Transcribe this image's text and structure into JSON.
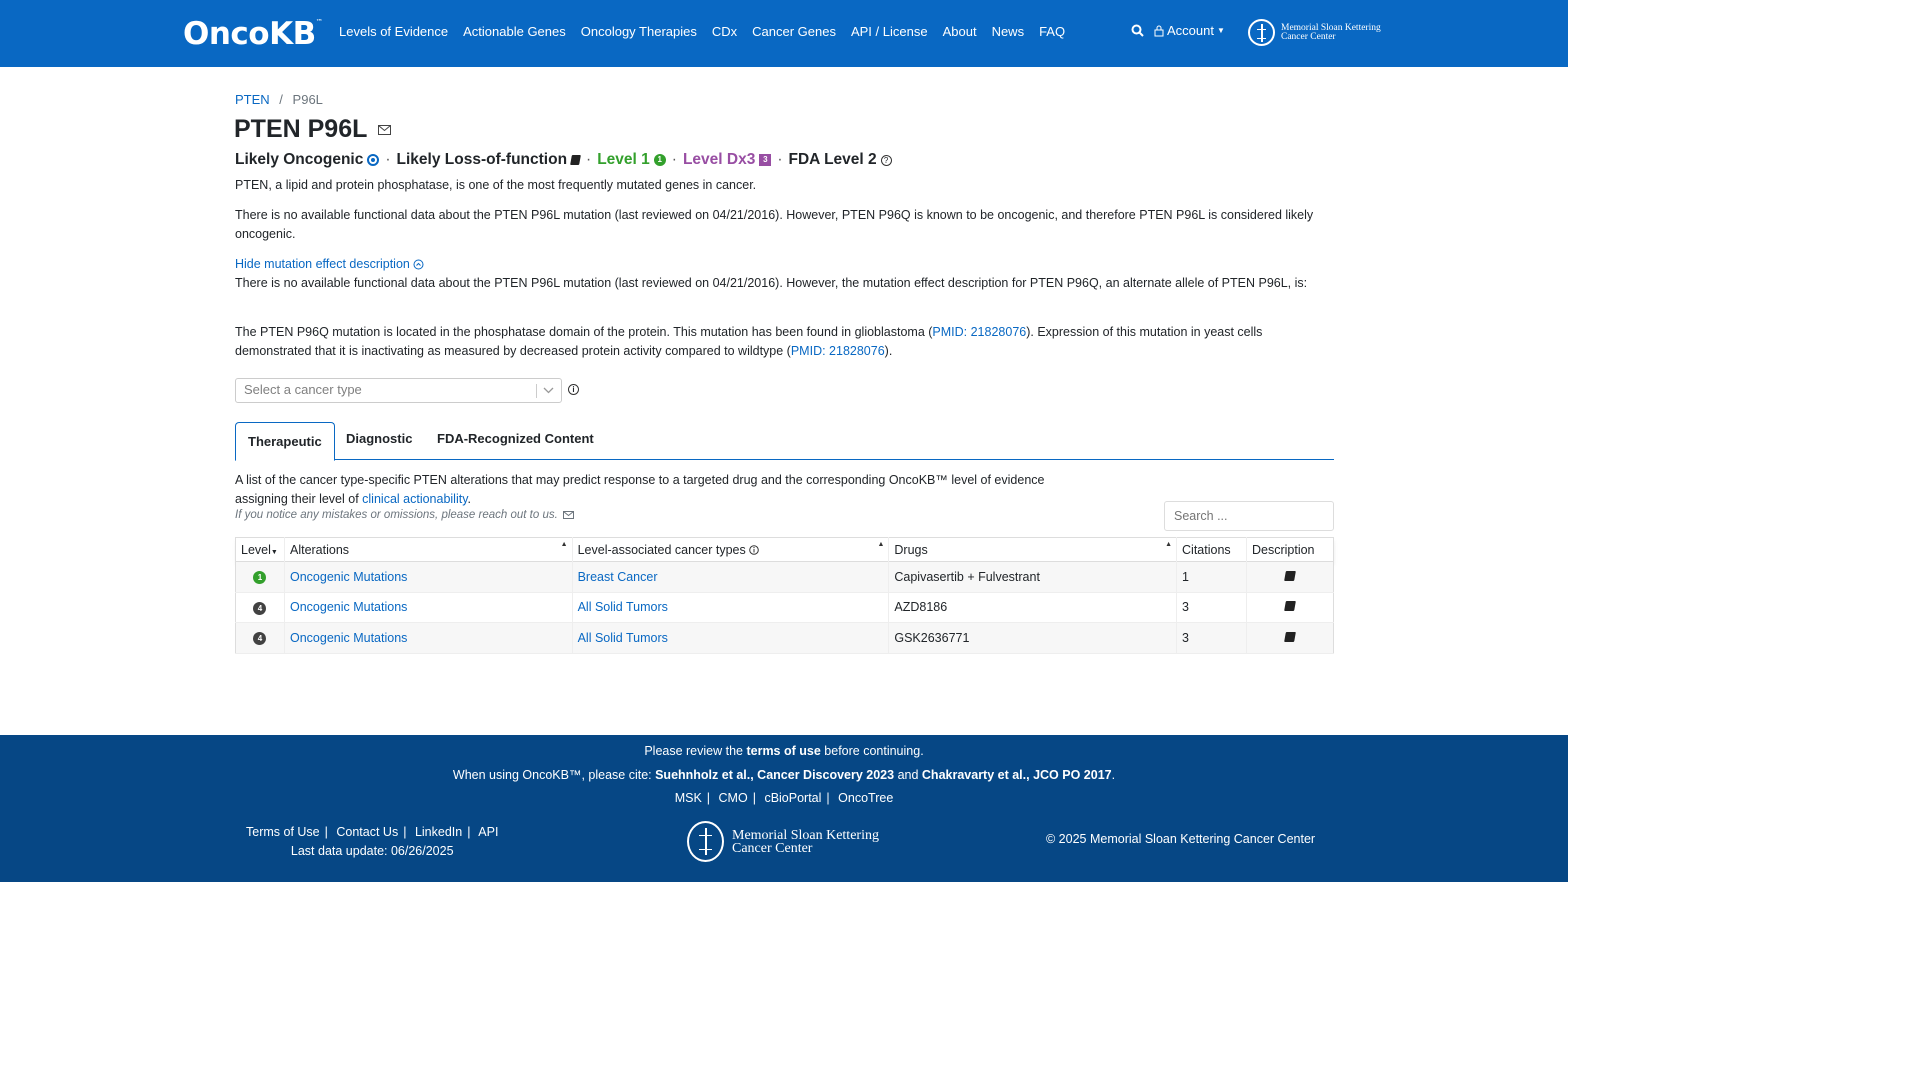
{
  "header": {
    "logo": "OncoKB",
    "logo_tm": "™",
    "nav": [
      "Levels of Evidence",
      "Actionable Genes",
      "Oncology Therapies",
      "CDx",
      "Cancer Genes",
      "API / License",
      "About",
      "News",
      "FAQ"
    ],
    "account": "Account",
    "msk_line1": "Memorial Sloan Kettering",
    "msk_line2": "Cancer Center"
  },
  "breadcrumb": {
    "gene": "PTEN",
    "sep": "/",
    "alteration": "P96L"
  },
  "title": "PTEN P96L",
  "status": {
    "oncogenic": "Likely Oncogenic",
    "effect": "Likely Loss-of-function",
    "level": "Level 1",
    "level_badge": "1",
    "dx": "Level Dx3",
    "dx_badge": "3",
    "fda": "FDA Level 2",
    "dot": "·"
  },
  "summary": {
    "gene_summary": "PTEN, a lipid and protein phosphatase, is one of the most frequently mutated genes in cancer.",
    "variant_summary": "There is no available functional data about the PTEN P96L mutation (last reviewed on 04/21/2016). However, PTEN P96Q is known to be oncogenic, and therefore PTEN P96L is considered likely oncogenic.",
    "toggle": "Hide mutation effect description",
    "effect_1": "There is no available functional data about the PTEN P96L mutation (last reviewed on 04/21/2016). However, the mutation effect description for PTEN P96Q, an alternate allele of PTEN P96L, is:",
    "effect_2_a": "The PTEN P96Q mutation is located in the phosphatase domain of the protein. This mutation has been found in glioblastoma (",
    "pmid_1": "PMID: 21828076",
    "effect_2_b": "). Expression of this mutation in yeast cells demonstrated that it is inactivating as measured by decreased protein activity compared to wildtype (",
    "pmid_2": "PMID: 21828076",
    "effect_2_c": ")."
  },
  "cancer_select": {
    "placeholder": "Select a cancer type"
  },
  "tabs": [
    "Therapeutic",
    "Diagnostic",
    "FDA-Recognized Content"
  ],
  "therapeutic": {
    "desc_a": "A list of the cancer type-specific PTEN alterations that may predict response to a targeted drug and the corresponding OncoKB™ level of evidence assigning their level of ",
    "desc_link": "clinical actionability",
    "desc_b": ".",
    "note": "If you notice any mistakes or omissions, please reach out to us.",
    "search_placeholder": "Search ...",
    "columns": [
      "Level",
      "Alterations",
      "Level-associated cancer types",
      "Drugs",
      "Citations",
      "Description"
    ],
    "rows": [
      {
        "level": "1",
        "level_color": "#33a02c",
        "alteration": "Oncogenic Mutations",
        "cancer": "Breast Cancer",
        "drugs": "Capivasertib + Fulvestrant",
        "citations": "1"
      },
      {
        "level": "4",
        "level_color": "#424242",
        "alteration": "Oncogenic Mutations",
        "cancer": "All Solid Tumors",
        "drugs": "AZD8186",
        "citations": "3"
      },
      {
        "level": "4",
        "level_color": "#424242",
        "alteration": "Oncogenic Mutations",
        "cancer": "All Solid Tumors",
        "drugs": "GSK2636771",
        "citations": "3"
      }
    ]
  },
  "footer": {
    "review_a": "Please review the ",
    "review_link": "terms of use",
    "review_b": " before continuing.",
    "cite_a": "When using OncoKB™, please cite: ",
    "cite_1": "Suehnholz et al., Cancer Discovery 2023",
    "cite_and": " and ",
    "cite_2": "Chakravarty et al., JCO PO 2017",
    "cite_end": ".",
    "links": [
      "MSK",
      "CMO",
      "cBioPortal",
      "OncoTree"
    ],
    "left_links": [
      "Terms of Use",
      "Contact Us",
      "LinkedIn",
      "API"
    ],
    "last_update": "Last data update: 06/26/2025",
    "msk_line1": "Memorial Sloan Kettering",
    "msk_line2": "Cancer Center",
    "copyright": "© 2025 Memorial Sloan Kettering Cancer Center"
  }
}
